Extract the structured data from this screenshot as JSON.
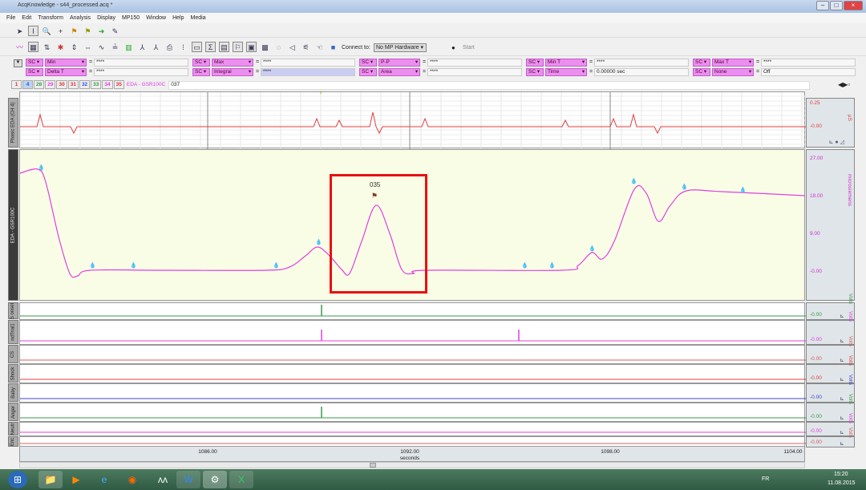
{
  "window": {
    "title": "AcqKnowledge - s44_processed.acq *"
  },
  "menu": [
    "File",
    "Edit",
    "Transform",
    "Analysis",
    "Display",
    "MP150",
    "Window",
    "Help",
    "Media"
  ],
  "toolbar": {
    "connect_label": "Connect to:",
    "connect_value": "No MP Hardware",
    "start_label": "Start"
  },
  "measurements": {
    "row1": [
      {
        "src": "SC",
        "fn": "Min",
        "val": "****"
      },
      {
        "src": "SC",
        "fn": "Max",
        "val": "****"
      },
      {
        "src": "SC",
        "fn": "P-P",
        "val": "****"
      },
      {
        "src": "SC",
        "fn": "Min T",
        "val": "****"
      },
      {
        "src": "SC",
        "fn": "Max T",
        "val": "****"
      }
    ],
    "row2": [
      {
        "src": "SC",
        "fn": "Delta T",
        "val": "****"
      },
      {
        "src": "SC",
        "fn": "Integral",
        "val": "****"
      },
      {
        "src": "SC",
        "fn": "Area",
        "val": "****"
      },
      {
        "src": "SC",
        "fn": "Time",
        "val": "0.00000 sec"
      },
      {
        "src": "SC",
        "fn": "None",
        "val": "Off"
      }
    ]
  },
  "channel_tabs": [
    {
      "n": "1",
      "c": "#e03030"
    },
    {
      "n": "4",
      "c": "#3050e0"
    },
    {
      "n": "28",
      "c": "#30a040"
    },
    {
      "n": "29",
      "c": "#e040e0"
    },
    {
      "n": "30",
      "c": "#e03030"
    },
    {
      "n": "31",
      "c": "#e03030"
    },
    {
      "n": "32",
      "c": "#3050e0"
    },
    {
      "n": "33",
      "c": "#30a040"
    },
    {
      "n": "34",
      "c": "#e040e0"
    },
    {
      "n": "35",
      "c": "#e03030"
    }
  ],
  "active_channel": {
    "name": "EDA - GSR100C",
    "comment": "037"
  },
  "channels": {
    "phasic": {
      "label": "Phasic EDA (CH 4)",
      "top": "0.25",
      "zero": "-0.00",
      "unit": "µS"
    },
    "eda": {
      "label": "EDA - GSR100C",
      "ticks": [
        "27.00",
        "18.00",
        "9.00",
        "-0.00"
      ],
      "unit": "microsiemens",
      "event_label": "035"
    },
    "small": [
      {
        "label": "S onset",
        "value": "-0.00",
        "unit": "Volts",
        "color": "#3a9a4a"
      },
      {
        "label": "ndTrial1",
        "value": "-0.00",
        "unit": "Volts",
        "color": "#e040e0"
      },
      {
        "label": "CS",
        "value": "-0.00",
        "unit": "Volts",
        "color": "#d06060"
      },
      {
        "label": "Shock",
        "value": "-0.00",
        "unit": "Volts",
        "color": "#e04040"
      },
      {
        "label": "Baby",
        "value": "-0.00",
        "unit": "Volts",
        "color": "#4040d0"
      },
      {
        "label": "Anger",
        "value": "-0.00",
        "unit": "Volts",
        "color": "#3a9a4a"
      },
      {
        "label": "Neutr",
        "value": "-0.00",
        "unit": "Volts",
        "color": "#e040e0"
      },
      {
        "label": "Enc",
        "value": "-0.00",
        "unit": "Volts",
        "color": "#d06060"
      }
    ]
  },
  "time_axis": {
    "ticks": [
      "1086.00",
      "1092.00",
      "1098.00",
      "1104.00"
    ],
    "label": "seconds"
  },
  "taskbar": {
    "time": "15:20",
    "date": "11.08.2015",
    "lang": "FR"
  },
  "colors": {
    "eda": "#e040e0",
    "highlight": "#e81010",
    "plot_bg": "#fafde6"
  }
}
